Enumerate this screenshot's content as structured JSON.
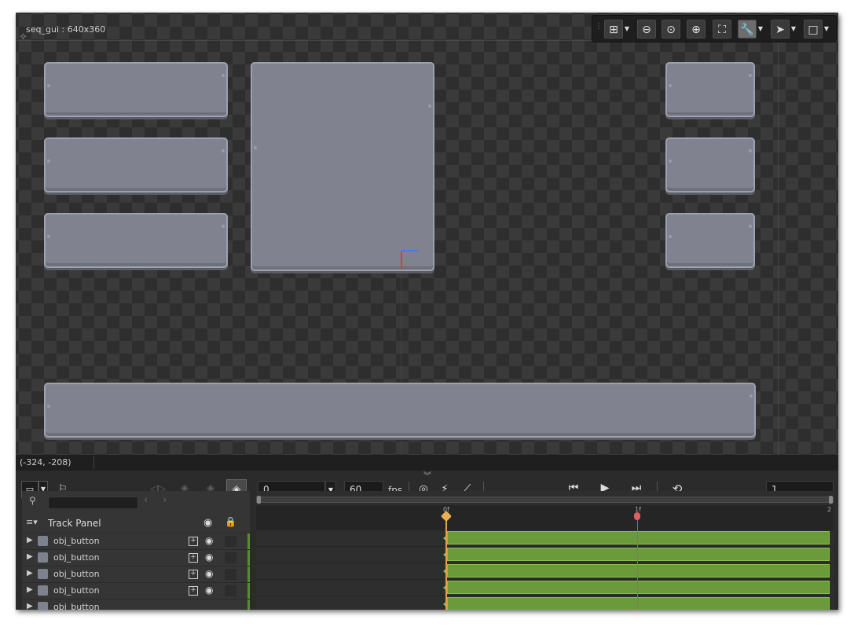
{
  "canvas": {
    "room_label": "seq_gui : 640x360",
    "toolbar": {
      "tools": [
        {
          "icon": "grid-icon"
        },
        {
          "icon": "zoom-out-icon"
        },
        {
          "icon": "zoom-reset-icon"
        },
        {
          "icon": "zoom-in-icon"
        },
        {
          "icon": "fit-view-icon"
        },
        {
          "icon": "wrench-icon"
        },
        {
          "icon": "pointer-icon"
        },
        {
          "icon": "background-color-icon"
        }
      ]
    }
  },
  "statusbar": {
    "coords": "(-324, -208)"
  },
  "sequence": {
    "current_frame": "0",
    "fps_value": "60",
    "fps_label": "fps",
    "length_value": "1",
    "track_panel": {
      "title": "Track Panel",
      "search_placeholder": "",
      "tracks": [
        {
          "name": "obj_button"
        },
        {
          "name": "obj_button"
        },
        {
          "name": "obj_button"
        },
        {
          "name": "obj_button"
        },
        {
          "name": "obj_button"
        }
      ]
    },
    "timeline": {
      "ticks": [
        "0f",
        "1f",
        "2"
      ]
    }
  },
  "colors": {
    "panel": "#80838f",
    "clip": "#6a9a3a",
    "playhead": "#e5a040",
    "end_marker": "#d65050",
    "gizmo_x": "#3f7be0",
    "gizmo_y": "#d04040"
  }
}
